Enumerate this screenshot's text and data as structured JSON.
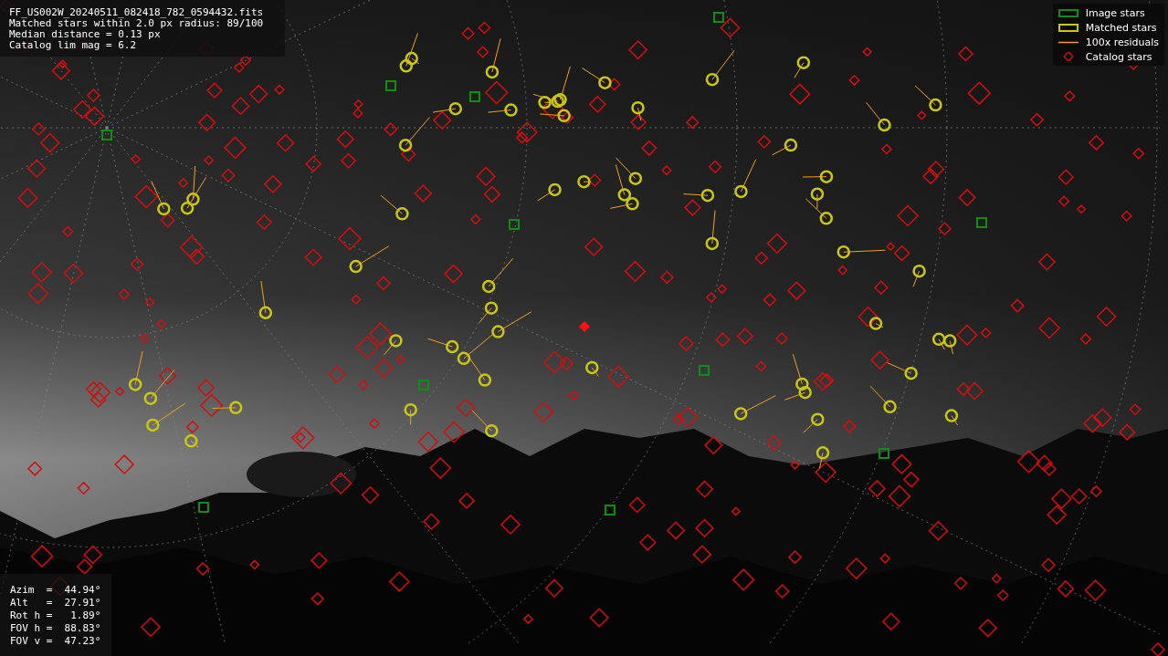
{
  "info": {
    "lines": [
      "FF_US002W_20240511_082418_782_0594432.fits",
      "Matched stars within 2.0 px radius: 89/100",
      "Median distance = 0.13 px",
      "Catalog lim mag = 6.2"
    ]
  },
  "legend": [
    {
      "kind": "box",
      "label": "Image stars",
      "color": "#148c14"
    },
    {
      "kind": "box",
      "label": "Matched stars",
      "color": "#c8c814"
    },
    {
      "kind": "line",
      "label": "100x residuals",
      "color": "#f0a020"
    },
    {
      "kind": "diamond",
      "label": "Catalog stars",
      "color": "#d01010"
    }
  ],
  "pointing": {
    "lines": [
      "Azim  =  44.94°",
      "Alt   =  27.91°",
      "Rot h =   1.89°",
      "FOV h =  88.83°",
      "FOV v =  47.23°"
    ]
  }
}
